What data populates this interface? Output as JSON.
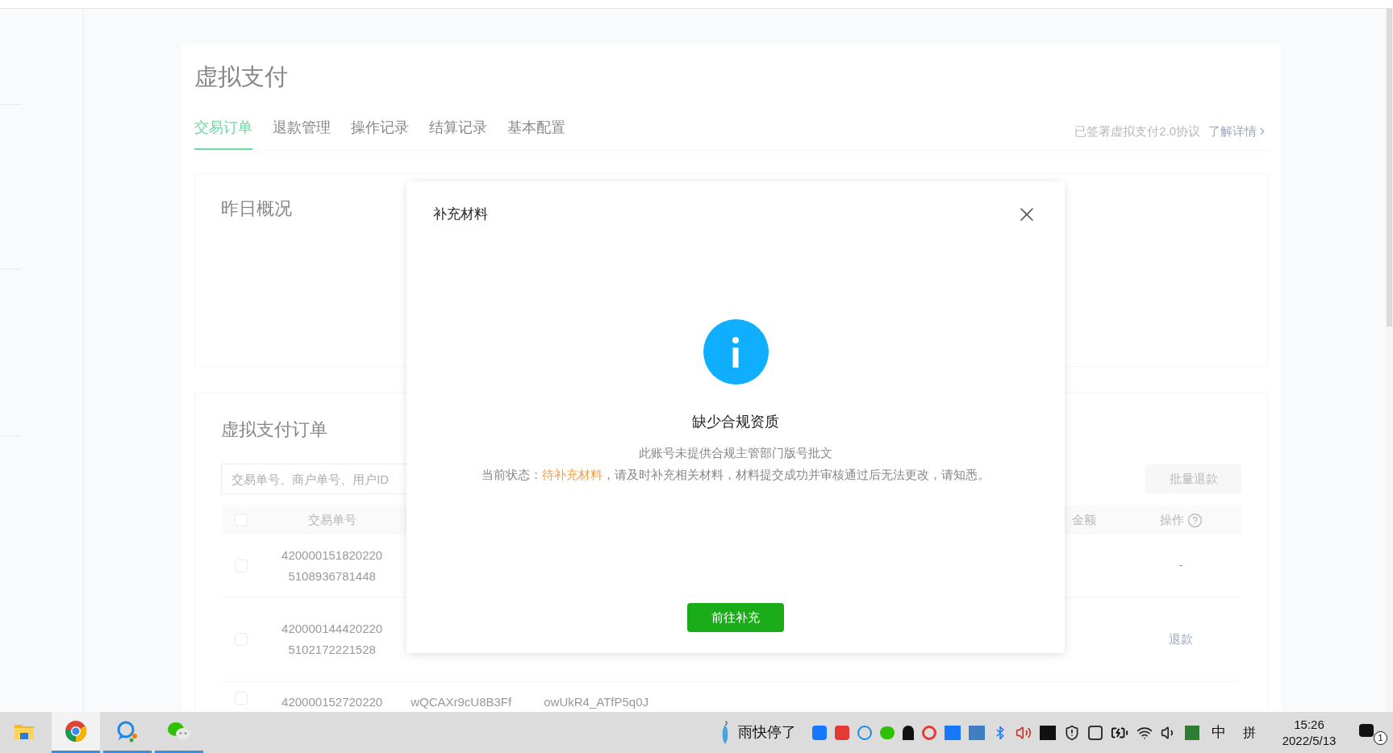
{
  "page": {
    "title": "虚拟支付",
    "tabs": [
      {
        "label": "交易订单",
        "selected": true
      },
      {
        "label": "退款管理",
        "selected": false
      },
      {
        "label": "操作记录",
        "selected": false
      },
      {
        "label": "结算记录",
        "selected": false
      },
      {
        "label": "基本配置",
        "selected": false
      }
    ],
    "agreement": "已签署虚拟支付2.0协议",
    "agreement_link": "了解详情",
    "summary_title": "昨日概况",
    "orders": {
      "title": "虚拟支付订单",
      "search_placeholder": "交易单号、商户单号、用户ID",
      "batch_refund": "批量退款",
      "columns": {
        "trade_no": "交易单号",
        "amount": "金额",
        "action": "操作"
      },
      "select_all": false,
      "rows": [
        {
          "trade_no": [
            "420000151820220",
            "5108936781448"
          ],
          "action": "-",
          "kind": "text",
          "checked": false
        },
        {
          "trade_no": [
            "420000144420220",
            "5102172221528"
          ],
          "action": "退款",
          "kind": "link",
          "checked": false
        },
        {
          "trade_no": [
            "420000152720220"
          ],
          "merchant_no": "wQCAXr9cU8B3Ff",
          "user_id": "owUkR4_ATfP5q0J",
          "checked": false
        }
      ]
    }
  },
  "dialog": {
    "title": "补充材料",
    "heading": "缺少合规资质",
    "message": "此账号未提供合规主管部门版号批文",
    "status_label": "当前状态：",
    "status": "待补充材料",
    "status_note": "，请及时补充相关材料，材料提交成功并审核通过后无法更改，请知悉。",
    "button": "前往补充"
  },
  "taskbar": {
    "apps": [
      {
        "kind": "folder",
        "selected": false,
        "running": false
      },
      {
        "kind": "chrome",
        "selected": true,
        "running": true
      },
      {
        "kind": "chat",
        "selected": false,
        "running": true
      },
      {
        "kind": "wechat",
        "selected": false,
        "running": true
      }
    ],
    "weather": "雨快停了",
    "ime": "中",
    "ime_mode": "拼",
    "time": "15:26",
    "date": "2022/5/13",
    "notifications": "1"
  }
}
